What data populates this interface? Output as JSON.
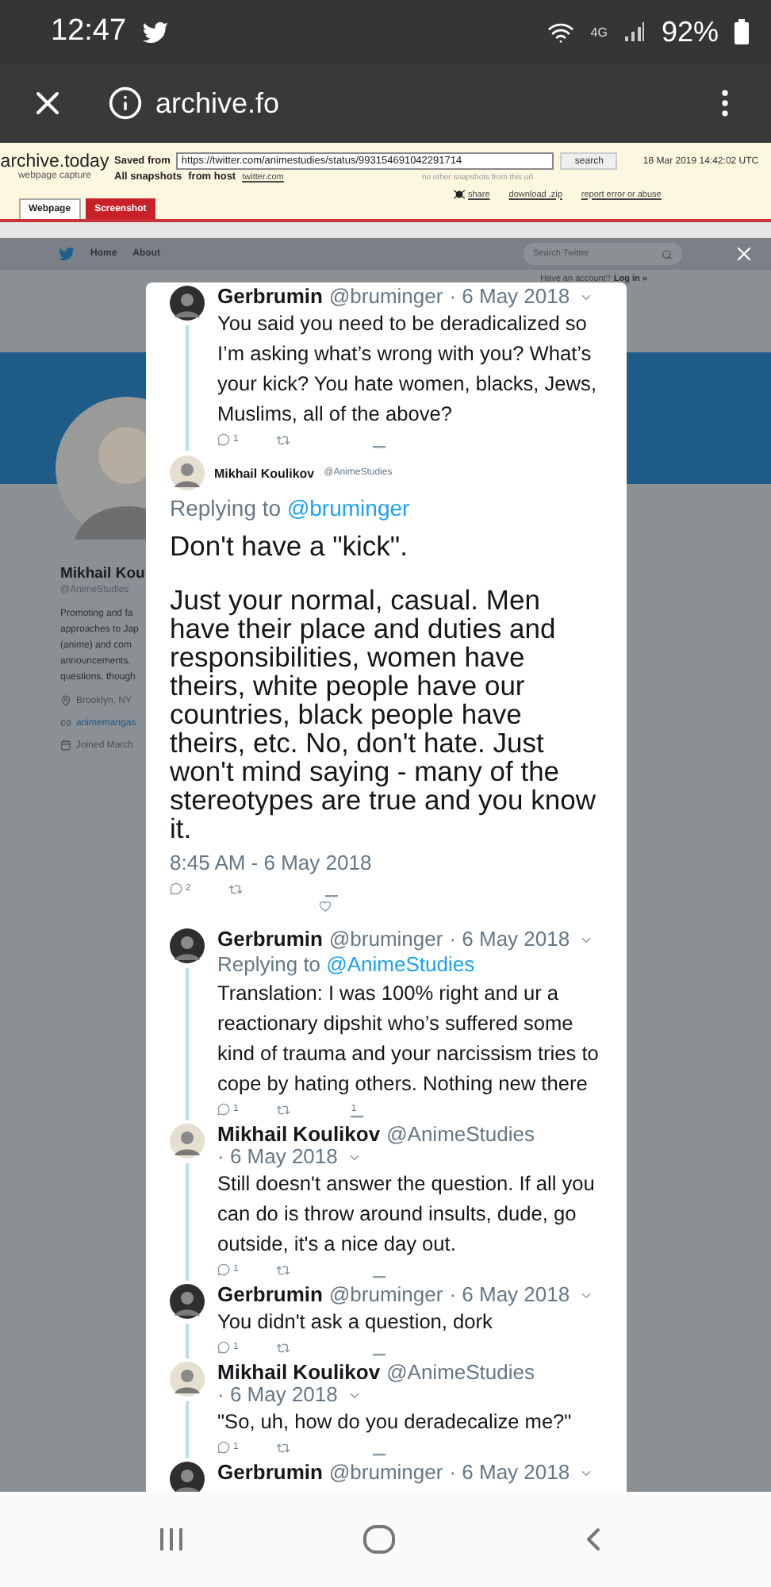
{
  "status_bar": {
    "time": "12:47",
    "network": "4G",
    "battery": "92%"
  },
  "browser": {
    "url": "archive.fo"
  },
  "archive_header": {
    "logo": "archive.today",
    "tagline": "webpage capture",
    "saved_from_label": "Saved from",
    "url": "https://twitter.com/animestudies/status/993154691042291714",
    "search_button": "search",
    "timestamp": "18 Mar 2019 14:42:02 UTC",
    "other_snapshots": "no other snapshots from this url",
    "all_snapshots_label": "All snapshots",
    "from_host_label": "from host",
    "host": "twitter.com",
    "tabs": [
      {
        "label": "Webpage",
        "selected": true
      },
      {
        "label": "Screenshot",
        "selected": false
      }
    ],
    "links": [
      {
        "label": "share",
        "kind": "share"
      },
      {
        "label": "download .zip",
        "kind": "plain"
      },
      {
        "label": "report error or abuse",
        "kind": "plain"
      }
    ]
  },
  "twitter_nav": {
    "items": [
      "Home",
      "About"
    ],
    "search": {
      "placeholder": "Search Twitter"
    },
    "login_prompt": "Have an account?",
    "login_link": "Log in »"
  },
  "profile": {
    "name": "Mikhail Kou",
    "handle": "@AnimeStudies",
    "bio": [
      "Promoting and fa",
      "approaches to Jap",
      "(anime) and com",
      "announcements,",
      "questions, though"
    ],
    "location": "Brooklyn, NY",
    "website": "animemangas",
    "joined": "Joined March"
  },
  "conversation": {
    "tweets": [
      {
        "kind": "reply",
        "author": "Gerbrumin",
        "handle": "@bruminger",
        "date": "· 6 May 2018",
        "color": "#2e2e2e",
        "connected": true,
        "text": "You said you need to be deradicalized so I’m asking what’s wrong with you? What’s your kick? You hate women, blacks, Jews, Muslims, all of the above?",
        "reply_count": "1"
      },
      {
        "kind": "focus",
        "author": "Mikhail Koulikov",
        "handle": "@AnimeStudies",
        "color": "#e6dfd0",
        "replying_label": "Replying to",
        "replying_to": "@bruminger",
        "paragraphs": [
          "Don't have a \"kick\".",
          "Just your normal, casual. Men have their place and duties and responsibilities, women have theirs, white people have our countries, black people have theirs, etc. No, don't hate. Just won't mind saying - many of the stereotypes are true and you know it."
        ],
        "time": "8:45 AM - 6 May 2018",
        "reply_count": "2"
      },
      {
        "kind": "reply",
        "author": "Gerbrumin",
        "handle": "@bruminger",
        "date": "· 6 May 2018",
        "color": "#2e2e2e",
        "connected": true,
        "replying_label": "Replying to",
        "replying_to": "@AnimeStudies",
        "text": "Translation: I was 100% right and ur a reactionary dipshit who’s suffered some kind of trauma and your narcissism tries to cope by hating others. Nothing new there",
        "reply_count": "1",
        "like_count": "1"
      },
      {
        "kind": "reply",
        "author": "Mikhail Koulikov",
        "handle": "@AnimeStudies",
        "date": "· 6 May 2018",
        "color": "#e6dfd0",
        "connected": true,
        "text": "Still doesn't answer the question. If all you can do is throw around insults, dude, go outside, it's a nice day out.",
        "reply_count": "1"
      },
      {
        "kind": "reply",
        "author": "Gerbrumin",
        "handle": "@bruminger",
        "date": "· 6 May 2018",
        "color": "#2e2e2e",
        "connected": true,
        "text": "You didn't ask a question, dork",
        "reply_count": "1"
      },
      {
        "kind": "reply",
        "author": "Mikhail Koulikov",
        "handle": "@AnimeStudies",
        "date": "· 6 May 2018",
        "color": "#e6dfd0",
        "connected": true,
        "text": "\"So, uh, how do you deradecalize me?\"",
        "reply_count": "1"
      },
      {
        "kind": "header",
        "author": "Gerbrumin",
        "handle": "@bruminger",
        "date": "· 6 May 2018",
        "color": "#2e2e2e"
      }
    ]
  }
}
